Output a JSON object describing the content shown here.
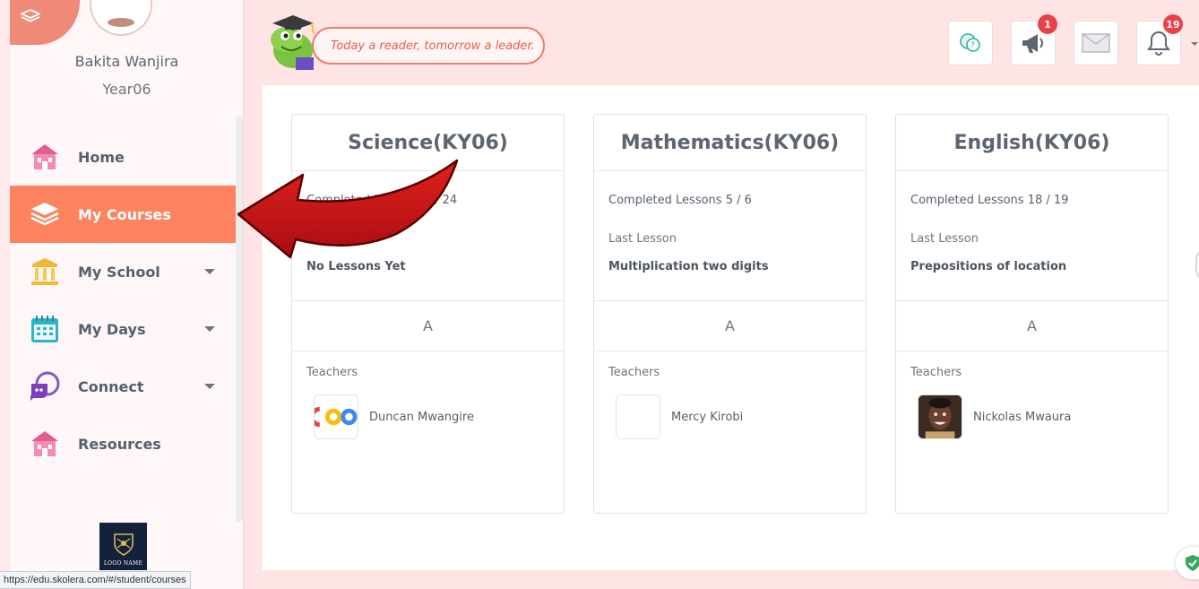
{
  "user": {
    "name": "Bakita Wanjira",
    "class": "Year06"
  },
  "motto": "Today a reader, tomorrow a leader.",
  "nav": [
    {
      "label": "Home",
      "icon": "home-icon",
      "active": false,
      "dropdown": false
    },
    {
      "label": "My Courses",
      "icon": "courses-icon",
      "active": true,
      "dropdown": false
    },
    {
      "label": "My School",
      "icon": "school-icon",
      "active": false,
      "dropdown": true
    },
    {
      "label": "My Days",
      "icon": "calendar-icon",
      "active": false,
      "dropdown": true
    },
    {
      "label": "Connect",
      "icon": "connect-icon",
      "active": false,
      "dropdown": true
    },
    {
      "label": "Resources",
      "icon": "resources-icon",
      "active": false,
      "dropdown": false
    }
  ],
  "header": {
    "announcements_badge": "1",
    "notifications_badge": "19"
  },
  "school_logo_text": "LOGO NAME",
  "status_url": "https://edu.skolera.com/#/student/courses",
  "courses": [
    {
      "title": "Science(KY06)",
      "completed": "Completed Lessons 0 / 24",
      "last_label": "Last Lesson",
      "last_lesson": "No Lessons Yet",
      "grade": "A",
      "teachers_label": "Teachers",
      "teacher": "Duncan Mwangire"
    },
    {
      "title": "Mathematics(KY06)",
      "completed": "Completed Lessons 5 / 6",
      "last_label": "Last Lesson",
      "last_lesson": "Multiplication two digits",
      "grade": "A",
      "teachers_label": "Teachers",
      "teacher": "Mercy Kirobi"
    },
    {
      "title": "English(KY06)",
      "completed": "Completed Lessons 18 / 19",
      "last_label": "Last Lesson",
      "last_lesson": "Prepositions of location",
      "grade": "A",
      "teachers_label": "Teachers",
      "teacher": "Nickolas Mwaura"
    }
  ],
  "colors": {
    "accent": "#fd8360",
    "page_bg": "#ffe4e6",
    "badge": "#e8424a",
    "arrow": "#c8181a"
  }
}
